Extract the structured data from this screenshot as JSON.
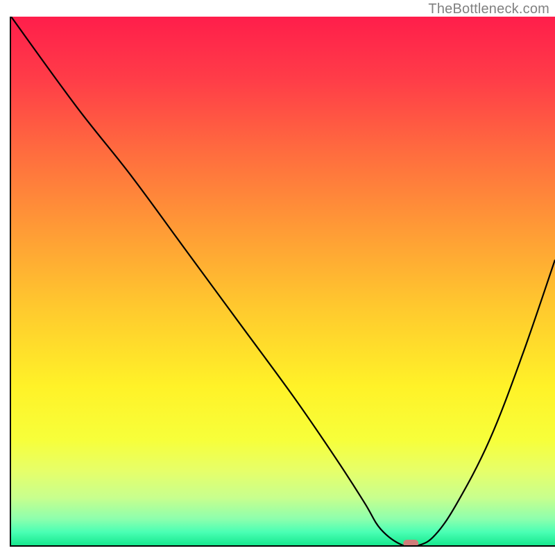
{
  "watermark": "TheBottleneck.com",
  "chart_data": {
    "type": "line",
    "title": "",
    "xlabel": "",
    "ylabel": "",
    "xlim": [
      0,
      100
    ],
    "ylim": [
      0,
      100
    ],
    "grid": false,
    "legend": false,
    "background_gradient": {
      "stops": [
        {
          "pos": 0.0,
          "color": "#ff1e4b"
        },
        {
          "pos": 0.12,
          "color": "#ff3d48"
        },
        {
          "pos": 0.25,
          "color": "#ff6a3f"
        },
        {
          "pos": 0.4,
          "color": "#ff9a36"
        },
        {
          "pos": 0.55,
          "color": "#ffc92e"
        },
        {
          "pos": 0.7,
          "color": "#fff228"
        },
        {
          "pos": 0.8,
          "color": "#f7ff3a"
        },
        {
          "pos": 0.86,
          "color": "#e6ff6a"
        },
        {
          "pos": 0.91,
          "color": "#c8ff8e"
        },
        {
          "pos": 0.95,
          "color": "#8dffad"
        },
        {
          "pos": 0.975,
          "color": "#4affb4"
        },
        {
          "pos": 1.0,
          "color": "#17e88e"
        }
      ]
    },
    "series": [
      {
        "name": "bottleneck-curve",
        "stroke": "#000000",
        "x": [
          0,
          12,
          22,
          32,
          42,
          52,
          60,
          65,
          68,
          72,
          75,
          78,
          82,
          88,
          94,
          100
        ],
        "y": [
          100,
          83,
          70,
          56,
          42,
          28,
          16,
          8,
          3,
          0,
          0,
          2,
          8,
          20,
          36,
          54
        ]
      }
    ],
    "marker": {
      "name": "highlight-pill",
      "x": 73.5,
      "y": 0,
      "color": "#d07d7a"
    }
  }
}
